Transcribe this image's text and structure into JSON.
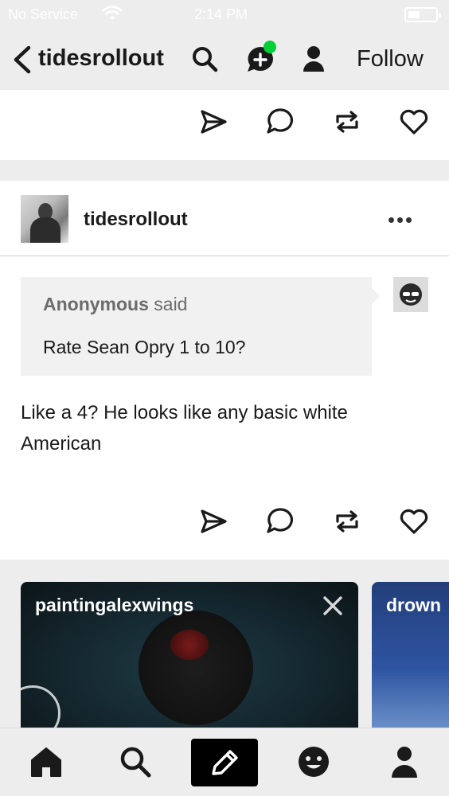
{
  "status_bar": {
    "carrier": "No Service",
    "time": "2:14 PM"
  },
  "header": {
    "blog_name": "tidesrollout",
    "follow_label": "Follow"
  },
  "post": {
    "author": "tidesrollout",
    "ask": {
      "asker": "Anonymous",
      "said": "said",
      "question": "Rate Sean Opry 1 to 10?"
    },
    "answer": "Like a 4? He looks like any basic white American"
  },
  "carousel": [
    {
      "name": "paintingalexwings"
    },
    {
      "name": "drown"
    }
  ],
  "icons": {
    "back": "chevron-left-icon",
    "search": "search-icon",
    "messages": "chat-plus-icon",
    "account": "person-icon",
    "share": "send-icon",
    "reply": "comment-icon",
    "reblog": "reblog-icon",
    "like": "heart-icon",
    "more": "ellipsis-icon",
    "close": "close-icon",
    "home": "home-icon",
    "explore": "search-icon",
    "compose": "pencil-icon",
    "activity": "smiley-icon",
    "profile": "person-icon"
  },
  "colors": {
    "accent_green": "#00cf35",
    "background": "#ededed",
    "card": "#ffffff"
  }
}
